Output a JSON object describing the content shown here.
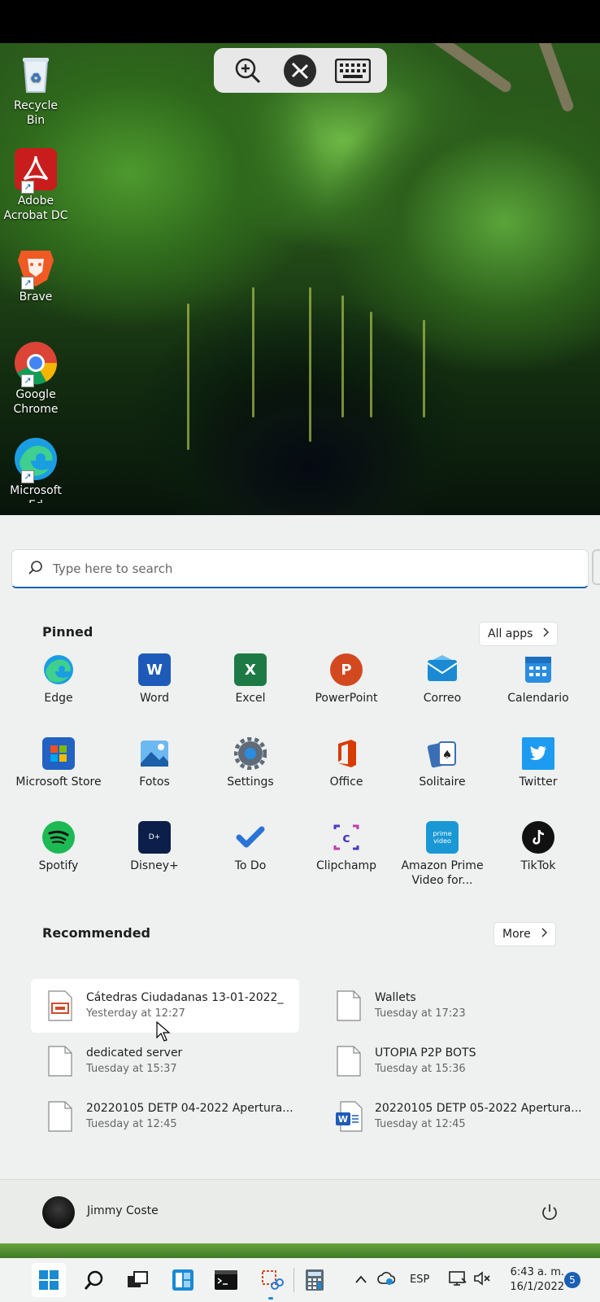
{
  "desktop": {
    "icons": [
      {
        "label": "Recycle Bin"
      },
      {
        "label": "Adobe Acrobat DC"
      },
      {
        "label": "Brave"
      },
      {
        "label": "Google Chrome"
      },
      {
        "label": "Microsoft Ed"
      }
    ]
  },
  "remote_toolbar": {
    "zoom": "zoom-in-icon",
    "remote": "remote-desktop-icon",
    "keyboard": "keyboard-icon"
  },
  "start_menu": {
    "search_placeholder": "Type here to search",
    "pinned_title": "Pinned",
    "all_apps_label": "All apps",
    "pinned": [
      {
        "label": "Edge",
        "color": "#0f7fd6"
      },
      {
        "label": "Word",
        "color": "#1e5bb8"
      },
      {
        "label": "Excel",
        "color": "#1d7a44"
      },
      {
        "label": "PowerPoint",
        "color": "#d2491f"
      },
      {
        "label": "Correo",
        "color": "#1a8ad4"
      },
      {
        "label": "Calendario",
        "color": "#2a8de0"
      },
      {
        "label": "Microsoft Store",
        "color": "#2162c2"
      },
      {
        "label": "Fotos",
        "color": "#3a8de0"
      },
      {
        "label": "Settings",
        "color": "#5f6b78"
      },
      {
        "label": "Office",
        "color": "#d83b01"
      },
      {
        "label": "Solitaire",
        "color": "#3b6fb5"
      },
      {
        "label": "Twitter",
        "color": "#1d9bf0"
      },
      {
        "label": "Spotify",
        "color": "#1db954"
      },
      {
        "label": "Disney+",
        "color": "#0c1f4b"
      },
      {
        "label": "To Do",
        "color": "#2b73d8"
      },
      {
        "label": "Clipchamp",
        "color": "#4b3bc4"
      },
      {
        "label": "Amazon Prime Video for...",
        "color": "#1a98d5"
      },
      {
        "label": "TikTok",
        "color": "#111111"
      }
    ],
    "recommended_title": "Recommended",
    "more_label": "More",
    "recommended": [
      {
        "title": "Cátedras Ciudadanas 13-01-2022_",
        "time": "Yesterday at 12:27"
      },
      {
        "title": "Wallets",
        "time": "Tuesday at 17:23"
      },
      {
        "title": "dedicated server",
        "time": "Tuesday at 15:37"
      },
      {
        "title": "UTOPIA P2P BOTS",
        "time": "Tuesday at 15:36"
      },
      {
        "title": "20220105 DETP 04-2022 Apertura...",
        "time": "Tuesday at 12:45"
      },
      {
        "title": "20220105 DETP 05-2022 Apertura...",
        "time": "Tuesday at 12:45"
      }
    ],
    "user_name": "Jimmy Coste"
  },
  "taskbar": {
    "lang": "ESP",
    "time": "6:43 a. m.",
    "date": "16/1/2022",
    "notifications": "5"
  }
}
